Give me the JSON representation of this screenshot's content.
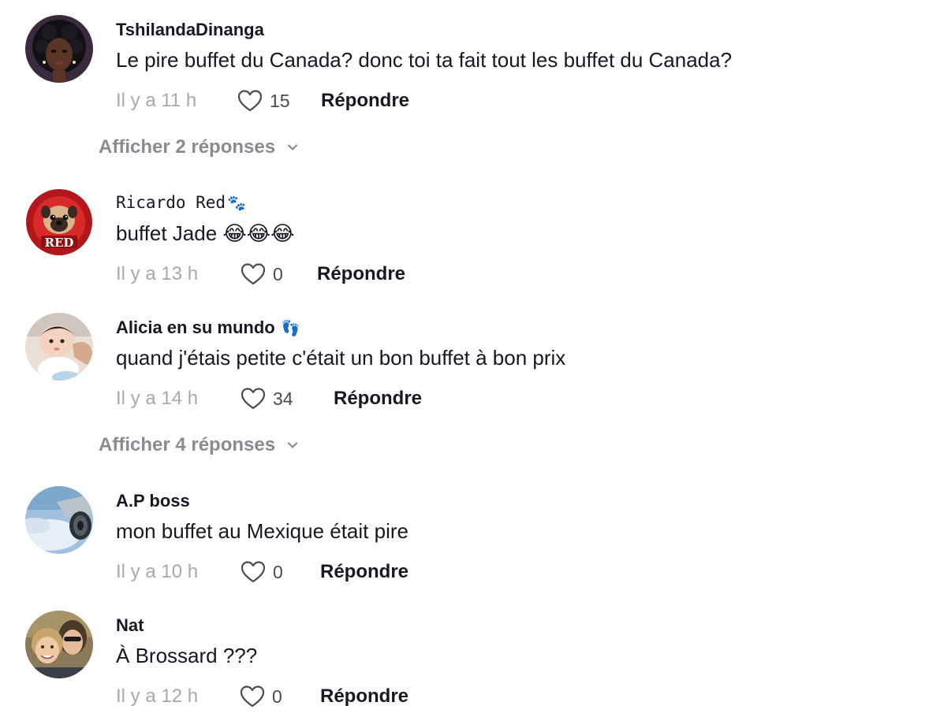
{
  "comments": [
    {
      "username": "TshilandaDinanga",
      "text": "Le pire buffet du Canada? donc toi ta fait tout les buffet du Canada?",
      "time": "Il y a 11 h",
      "likes": "15",
      "reply_label": "Répondre",
      "avatar_icon": "avatar-woman-dark-hair"
    },
    {
      "username": "Ricardo Red",
      "username_deco": "🐾",
      "text": "buffet Jade 😂😂😂",
      "time": "Il y a 13 h",
      "likes": "0",
      "reply_label": "Répondre",
      "avatar_icon": "avatar-pug-red-logo",
      "avatar_logo_text": "RED"
    },
    {
      "username": "Alicia en su mundo",
      "username_deco": "👣",
      "text": "quand j'étais petite c'était un bon buffet à bon prix",
      "time": "Il y a 14 h",
      "likes": "34",
      "reply_label": "Répondre",
      "avatar_icon": "avatar-baby"
    },
    {
      "username": "A.P boss",
      "text": "mon buffet au Mexique était pire",
      "time": "Il y a 10 h",
      "likes": "0",
      "reply_label": "Répondre",
      "avatar_icon": "avatar-airplane-engine-sky"
    },
    {
      "username": "Nat",
      "text": "À Brossard ???",
      "time": "Il y a 12 h",
      "likes": "0",
      "reply_label": "Répondre",
      "avatar_icon": "avatar-two-women-selfie"
    }
  ],
  "view_replies": [
    {
      "label": "Afficher 2 réponses",
      "icon": "chevron-down-icon"
    },
    {
      "label": "Afficher 4 réponses",
      "icon": "chevron-down-icon"
    }
  ],
  "colors": {
    "text_primary": "#161823",
    "text_secondary": "#a8a8ad",
    "view_replies": "#8a8b91",
    "background": "#ffffff"
  }
}
